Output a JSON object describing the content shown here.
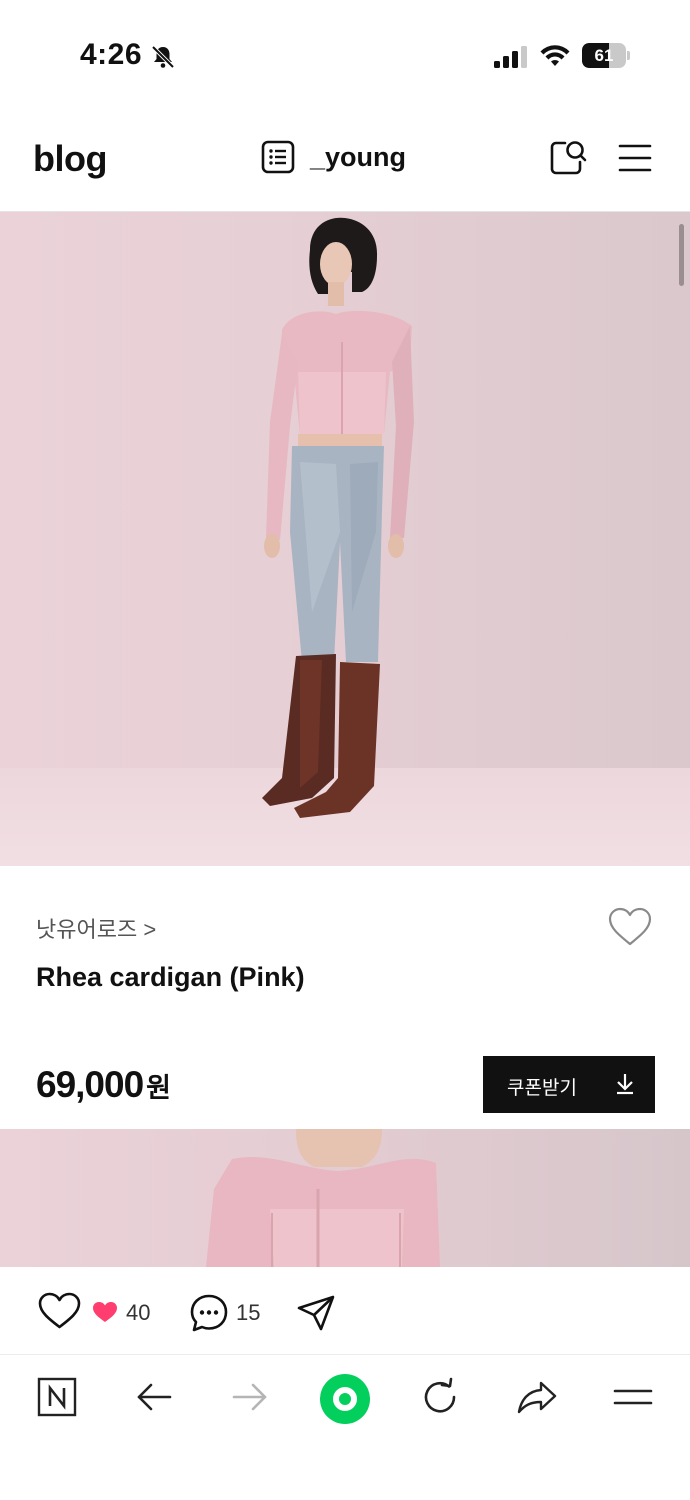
{
  "status_bar": {
    "time": "4:26",
    "battery": "61",
    "battery_level": 0.61
  },
  "header": {
    "logo": "blog",
    "username": "_young"
  },
  "product": {
    "brand": "낫유어로즈 >",
    "name": "Rhea cardigan (Pink)",
    "price": "69,000",
    "price_unit": "원",
    "coupon_label": "쿠폰받기"
  },
  "actions": {
    "like_count": "40",
    "comment_count": "15"
  },
  "colors": {
    "like_heart": "#ff3d6e",
    "home_button": "#03cf5d",
    "coupon_bg": "#111111"
  },
  "icons": [
    "bell-off-icon",
    "signal-icon",
    "wifi-icon",
    "battery-icon",
    "list-icon",
    "blog-search-icon",
    "hamburger-menu-icon",
    "heart-outline-icon",
    "download-icon",
    "like-icon",
    "heart-filled-icon",
    "comment-icon",
    "send-icon",
    "naver-icon",
    "back-arrow-icon",
    "forward-arrow-icon",
    "home-circle-icon",
    "reload-icon",
    "share-arrow-icon",
    "menu-icon"
  ]
}
